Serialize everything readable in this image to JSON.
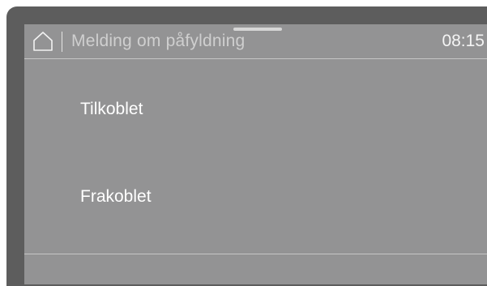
{
  "header": {
    "home_icon": "home-icon",
    "title": "Melding om påfyldning",
    "time": "08:15"
  },
  "options": [
    {
      "label": "Tilkoblet"
    },
    {
      "label": "Frakoblet"
    }
  ],
  "colors": {
    "screen_background": "#939394",
    "frame": "#5d5d5d",
    "text": "#ffffff"
  }
}
